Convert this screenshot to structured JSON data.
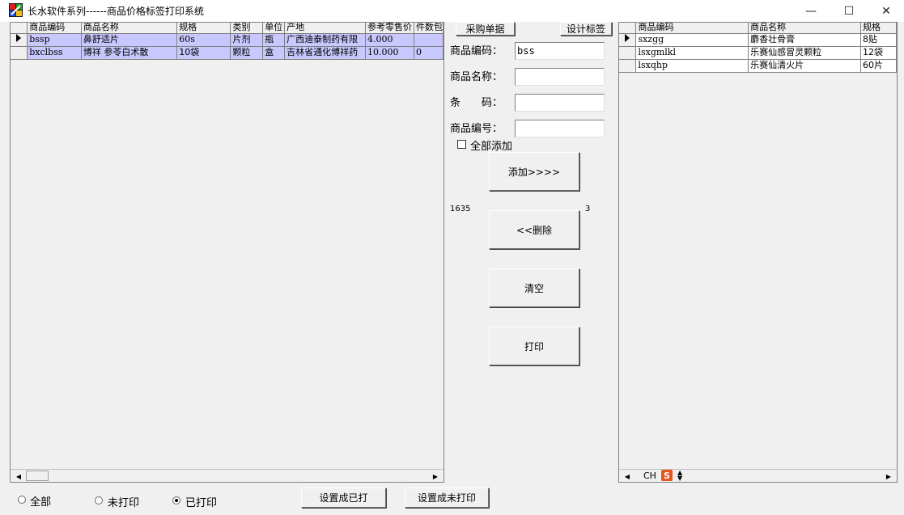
{
  "window": {
    "title": "长水软件系列------商品价格标签打印系统",
    "minimize": "—",
    "maximize": "☐",
    "close": "✕"
  },
  "left_grid": {
    "columns": [
      "商品编码",
      "商品名称",
      "规格",
      "类别",
      "单位",
      "产地",
      "参考零售价",
      "件数包"
    ],
    "rows": [
      [
        "bssp",
        "鼻舒适片",
        "60s",
        "片剂",
        "瓶",
        "广西迪泰制药有限",
        "4.000",
        ""
      ],
      [
        "bxclbss",
        "博祥 参苓白术散",
        "10袋",
        "颗粒",
        "盒",
        "吉林省通化博祥药",
        "10.000",
        "0"
      ]
    ]
  },
  "right_grid": {
    "columns": [
      "商品编码",
      "商品名称",
      "规格"
    ],
    "rows": [
      [
        "sxzgg",
        "麝香壮骨膏",
        "8贴"
      ],
      [
        "lsxgmlkl",
        "乐赛仙感冒灵颗粒",
        "12袋"
      ],
      [
        "lsxqhp",
        "乐赛仙清火片",
        "60片"
      ]
    ]
  },
  "middle": {
    "purchase_btn": "采购单据",
    "design_btn": "设计标签",
    "code_label": "商品编码：",
    "code_value": "bss",
    "name_label": "商品名称：",
    "name_value": "",
    "barcode_label": "条　　码：",
    "barcode_value": "",
    "number_label": "商品编号：",
    "number_value": "",
    "add_all_label": "全部添加",
    "add_btn": "添加>>>>",
    "left_count": "1635",
    "right_count": "3",
    "delete_btn": "<<删除",
    "clear_btn": "清空",
    "print_btn": "打印"
  },
  "bottom": {
    "radio_all": "全部",
    "radio_unprinted": "未打印",
    "radio_printed": "已打印",
    "selected_radio": "已打印",
    "set_printed_btn": "设置成已打",
    "set_unprinted_btn": "设置成未打印"
  },
  "ime": {
    "lang": "CH",
    "logo": "S"
  },
  "colors": {
    "selected_row": "#c8c8ff",
    "ime_logo": "#e8541e"
  }
}
